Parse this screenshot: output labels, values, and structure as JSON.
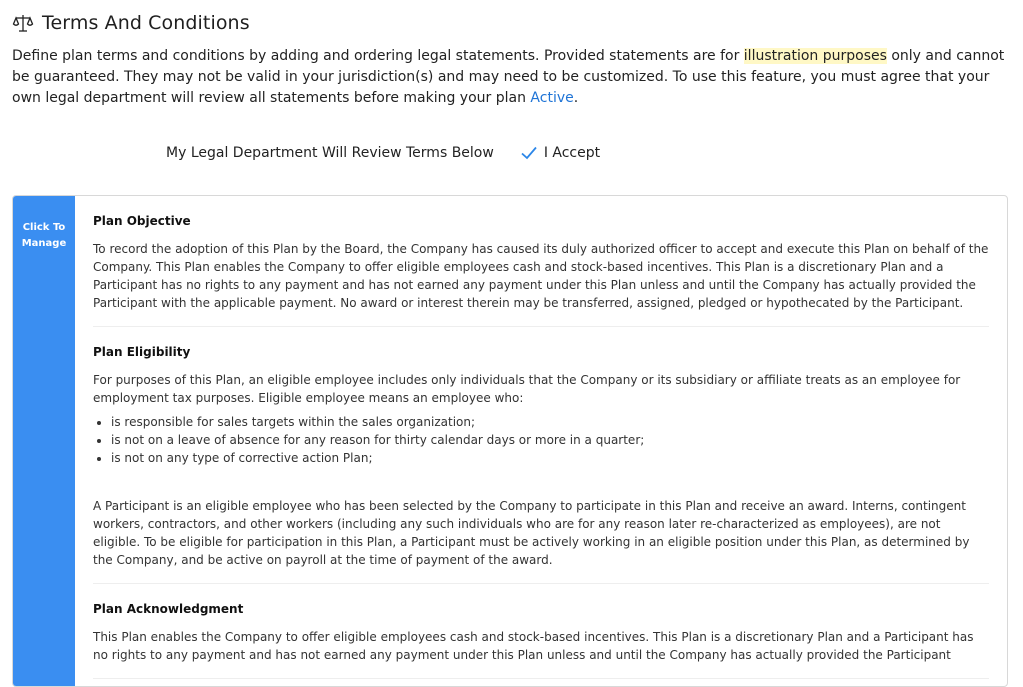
{
  "header": {
    "title": "Terms And Conditions",
    "icon": "scales-icon"
  },
  "intro": {
    "part1": "Define plan terms and conditions by adding and ordering legal statements. Provided statements are for ",
    "highlight": "illustration purposes",
    "part2": " only and cannot be guaranteed. They may not be valid in your jurisdiction(s) and may need to be customized. To use this feature, you must agree that your own legal department will review all statements before making your plan ",
    "link": "Active",
    "part3": "."
  },
  "accept": {
    "label": "My Legal Department Will Review Terms Below",
    "button": "I Accept"
  },
  "manage": {
    "label": "Click To Manage"
  },
  "sections": [
    {
      "title": "Plan Objective",
      "text": "To record the adoption of this Plan by the Board, the Company has caused its duly authorized officer to accept and execute this Plan on behalf of the Company. This Plan enables the Company to offer eligible employees cash and stock-based incentives. This Plan is a discretionary Plan and a Participant has no rights to any payment and has not earned any payment under this Plan unless and until the Company has actually provided the Participant with the applicable payment. No award or interest therein may be transferred, assigned, pledged or hypothecated by the Participant."
    },
    {
      "title": "Plan Eligibility",
      "text": "For purposes of this Plan, an eligible employee includes only individuals that the Company or its subsidiary or affiliate treats as an employee for employment tax purposes. Eligible employee means an employee who:",
      "bullets": [
        "is responsible for sales targets within the sales organization;",
        "is not on a leave of absence for any reason for thirty calendar days or more in a quarter;",
        "is not on any type of corrective action Plan;"
      ],
      "text2": "A Participant is an eligible employee who has been selected by the Company to participate in this Plan and receive an award. Interns, contingent workers, contractors, and other workers (including any such individuals who are for any reason later re-characterized as employees), are not eligible. To be eligible for participation in this Plan, a Participant must be actively working in an eligible position under this Plan, as determined by the Company, and be active on payroll at the time of payment of the award."
    },
    {
      "title": "Plan Acknowledgment",
      "text": "This Plan enables the Company to offer eligible employees cash and stock-based incentives. This Plan is a discretionary Plan and a Participant has no rights to any payment and has not earned any payment under this Plan unless and until the Company has actually provided the Participant"
    }
  ]
}
